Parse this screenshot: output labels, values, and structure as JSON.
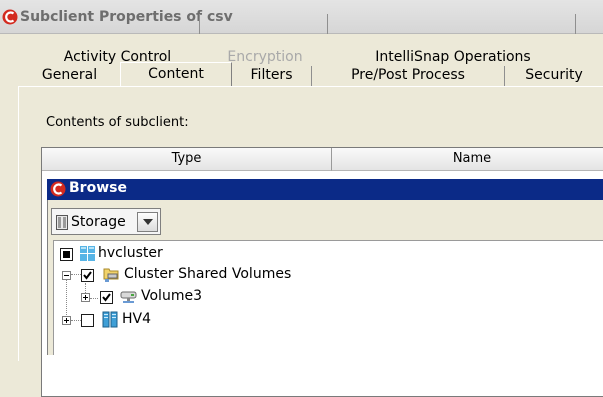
{
  "window": {
    "title": "Subclient Properties of csv"
  },
  "tabs": {
    "row1": [
      {
        "label": "Activity Control",
        "enabled": true
      },
      {
        "label": "Encryption",
        "enabled": false
      },
      {
        "label": "IntelliSnap Operations",
        "enabled": true
      }
    ],
    "row2": [
      {
        "label": "General",
        "enabled": true
      },
      {
        "label": "Content",
        "enabled": true,
        "active": true
      },
      {
        "label": "Filters",
        "enabled": true
      },
      {
        "label": "Pre/Post Process",
        "enabled": true
      },
      {
        "label": "Security",
        "enabled": true
      }
    ]
  },
  "content": {
    "label": "Contents of subclient:",
    "columns": [
      "Type",
      "Name"
    ]
  },
  "browse": {
    "title": "Browse",
    "view_selector": {
      "value": "Storage",
      "icon": "storage-icon"
    },
    "tree": [
      {
        "label": "hvcluster",
        "icon": "cluster-icon",
        "checkbox": "partial",
        "expander": null
      },
      {
        "label": "Cluster Shared Volumes",
        "icon": "shared-volumes-icon",
        "checkbox": "checked",
        "expander": "minus"
      },
      {
        "label": "Volume3",
        "icon": "volume-icon",
        "checkbox": "checked",
        "expander": "plus"
      },
      {
        "label": "HV4",
        "icon": "server-icon",
        "checkbox": "unchecked",
        "expander": "plus"
      }
    ]
  },
  "colors": {
    "dialog_bg": "#ece9d8",
    "browse_titlebar": "#0b2a87",
    "brand_red": "#d32a1f"
  }
}
